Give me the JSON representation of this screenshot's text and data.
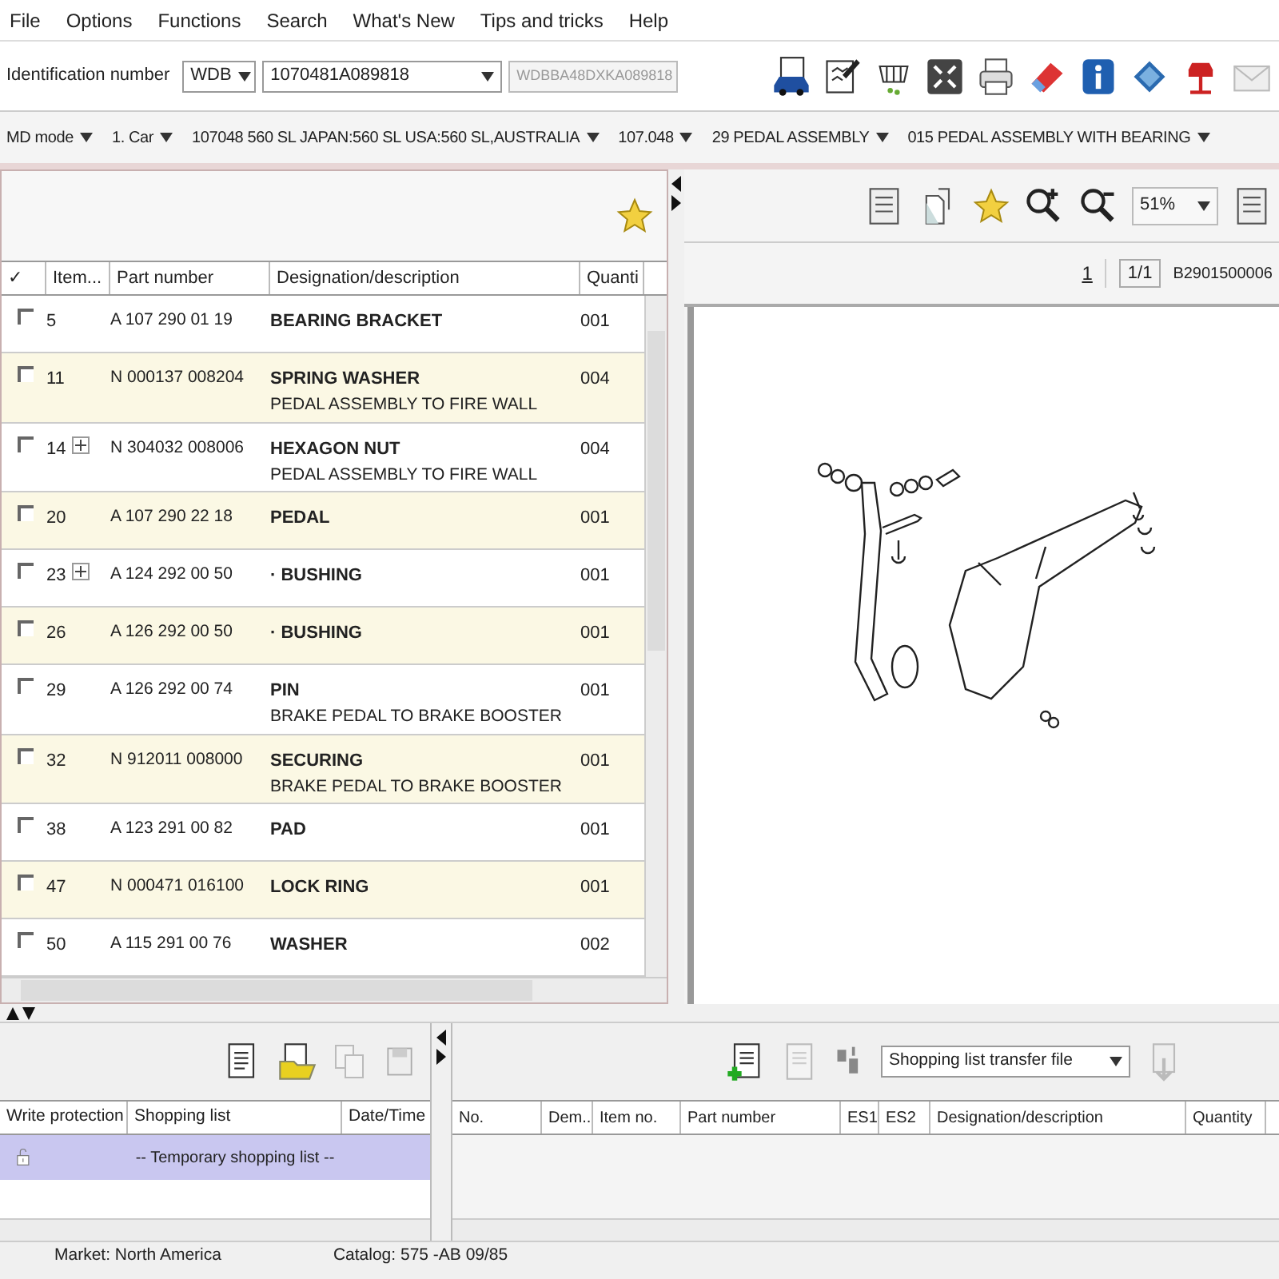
{
  "menu": [
    "File",
    "Options",
    "Functions",
    "Search",
    "What's New",
    "Tips and tricks",
    "Help"
  ],
  "identification": {
    "label": "Identification number",
    "prefix": "WDB",
    "number": "1070481A089818",
    "vin": "WDBBA48DXKA089818"
  },
  "breadcrumbs": [
    "MD mode",
    "1. Car",
    "107048 560 SL JAPAN:560 SL USA:560 SL,AUSTRALIA",
    "107.048",
    "29 PEDAL ASSEMBLY",
    "015 PEDAL ASSEMBLY WITH BEARING"
  ],
  "parts_table": {
    "columns": [
      "✓",
      "Item...",
      "Part number",
      "Designation/description",
      "Quanti"
    ],
    "rows": [
      {
        "checked": false,
        "item": "5",
        "expandable": false,
        "part_number": "A 107 290 01 19",
        "designation": "BEARING BRACKET",
        "quantity": "001"
      },
      {
        "checked": false,
        "item": "11",
        "expandable": false,
        "part_number": "N 000137 008204",
        "designation": "SPRING WASHER",
        "note": "PEDAL ASSEMBLY TO FIRE WALL",
        "quantity": "004"
      },
      {
        "checked": false,
        "item": "14",
        "expandable": true,
        "part_number": "N 304032 008006",
        "designation": "HEXAGON NUT",
        "note": "PEDAL ASSEMBLY TO FIRE WALL",
        "quantity": "004"
      },
      {
        "checked": false,
        "item": "20",
        "expandable": false,
        "part_number": "A 107 290 22 18",
        "designation": "PEDAL",
        "quantity": "001"
      },
      {
        "checked": false,
        "item": "23",
        "expandable": true,
        "part_number": "A 124 292 00 50",
        "designation": "· BUSHING",
        "quantity": "001"
      },
      {
        "checked": false,
        "item": "26",
        "expandable": false,
        "part_number": "A 126 292 00 50",
        "designation": "· BUSHING",
        "quantity": "001"
      },
      {
        "checked": false,
        "item": "29",
        "expandable": false,
        "part_number": "A 126 292 00 74",
        "designation": "PIN",
        "note": "BRAKE PEDAL TO BRAKE BOOSTER",
        "quantity": "001"
      },
      {
        "checked": false,
        "item": "32",
        "expandable": false,
        "part_number": "N 912011 008000",
        "designation": "SECURING",
        "note": "BRAKE PEDAL TO BRAKE BOOSTER",
        "quantity": "001"
      },
      {
        "checked": false,
        "item": "38",
        "expandable": false,
        "part_number": "A 123 291 00 82",
        "designation": "PAD",
        "quantity": "001"
      },
      {
        "checked": false,
        "item": "47",
        "expandable": false,
        "part_number": "N 000471 016100",
        "designation": "LOCK RING",
        "quantity": "001"
      },
      {
        "checked": false,
        "item": "50",
        "expandable": false,
        "part_number": "A 115 291 00 76",
        "designation": "WASHER",
        "quantity": "002"
      }
    ]
  },
  "viewer": {
    "zoom": "51%",
    "page": "1",
    "page_count": "1/1",
    "image_id": "B2901500006"
  },
  "shopping_lists": {
    "columns": [
      "Write protection",
      "Shopping list",
      "Date/Time"
    ],
    "rows": [
      {
        "selected": true,
        "name": "-- Temporary shopping list --"
      }
    ]
  },
  "shopping_items": {
    "transfer": "Shopping list transfer file",
    "columns": [
      "No.",
      "Dem...",
      "Item no.",
      "Part number",
      "ES1",
      "ES2",
      "Designation/description",
      "Quantity"
    ]
  },
  "status_bar": [
    "Market: North America",
    "Catalog: 575 -AB 09/85"
  ]
}
